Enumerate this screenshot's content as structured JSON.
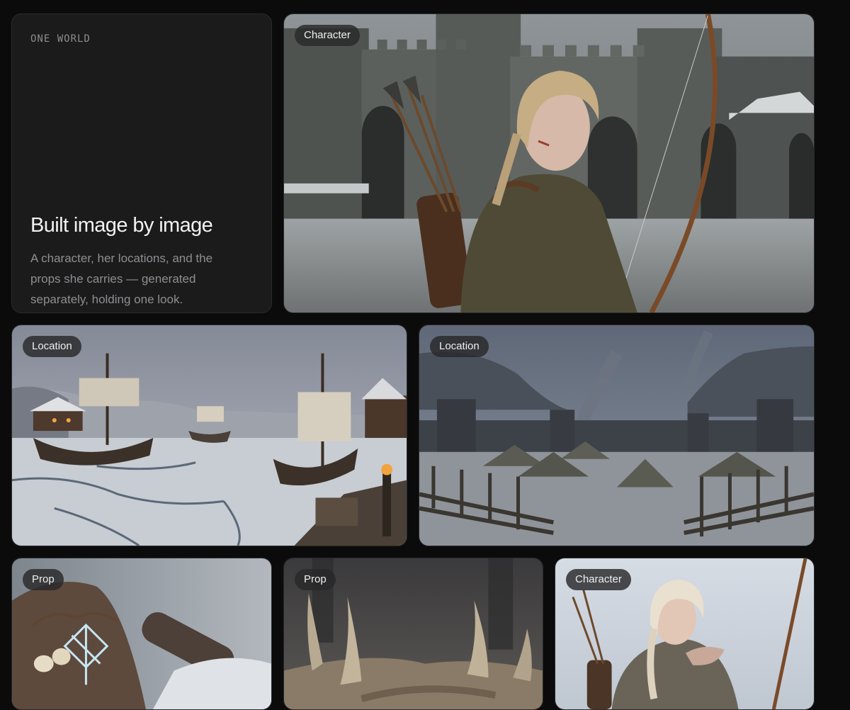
{
  "intro": {
    "eyebrow": "ONE WORLD",
    "title": "Built image by image",
    "description": "A character, her locations, and the props she carries — generated separately, holding one look."
  },
  "cards": [
    {
      "tag": "Character",
      "subject": "archer-girl-castle-courtyard"
    },
    {
      "tag": "Location",
      "subject": "frozen-harbor-longships"
    },
    {
      "tag": "Location",
      "subject": "winter-war-camp"
    },
    {
      "tag": "Prop",
      "subject": "rune-leather-pouch"
    },
    {
      "tag": "Prop",
      "subject": "antler-crown"
    },
    {
      "tag": "Character",
      "subject": "archer-girl-breathing-on-hands"
    }
  ]
}
